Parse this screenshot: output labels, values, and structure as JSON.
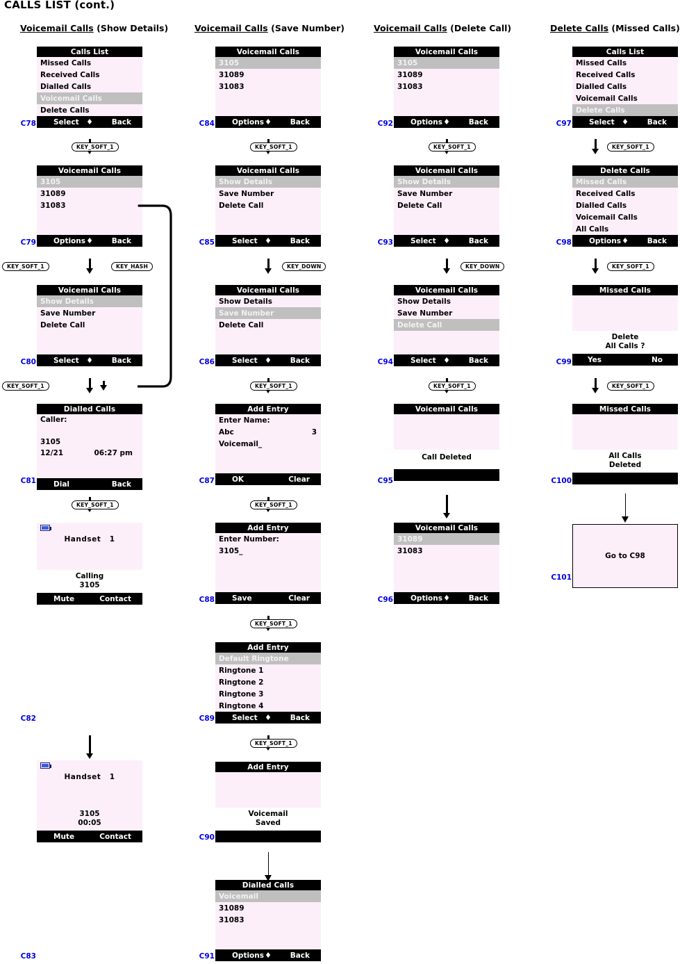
{
  "page": {
    "title": "CALLS LIST (cont.)",
    "columns": [
      {
        "underlined": "Voicemail Calls",
        "rest": " (Show Details)"
      },
      {
        "underlined": "Voicemail Calls",
        "rest": " (Save Number)"
      },
      {
        "underlined": "Voicemail Calls",
        "rest": " (Delete Call)"
      },
      {
        "underlined": "Delete Calls",
        "rest": " (Missed Calls)"
      }
    ]
  },
  "glyphs": {
    "updown": "♦",
    "battery": "battery-icon"
  },
  "keys": {
    "soft1": "KEY_SOFT_1",
    "hash": "KEY_HASH",
    "down": "KEY_DOWN"
  },
  "screens": {
    "C78": {
      "id": "C78",
      "header": "Calls List",
      "items": [
        "Missed Calls",
        "Received Calls",
        "Dialled Calls",
        "Voicemail Calls",
        "Delete Calls"
      ],
      "selected_index": 3,
      "soft": {
        "left": "Select",
        "right": "Back",
        "mid": true
      }
    },
    "C79": {
      "id": "C79",
      "header": "Voicemail Calls",
      "items": [
        "3105",
        "31089",
        "31083"
      ],
      "selected_index": 0,
      "soft": {
        "left": "Options",
        "right": "Back",
        "mid": true
      }
    },
    "C80": {
      "id": "C80",
      "header": "Voicemail Calls",
      "items": [
        "Show Details",
        "Save Number",
        "Delete Call"
      ],
      "selected_index": 0,
      "soft": {
        "left": "Select",
        "right": "Back",
        "mid": true
      }
    },
    "C81": {
      "id": "C81",
      "header": "Dialled Calls",
      "caller_label": "Caller:",
      "number": "3105",
      "date": "12/21",
      "time": "06:27 pm",
      "soft": {
        "left": "Dial",
        "right": "Back",
        "mid": false
      }
    },
    "C82": {
      "id": "C82",
      "handset_label": "Handset",
      "handset_number": "1",
      "status_line1": "Calling",
      "status_line2": "3105",
      "soft": {
        "left": "Mute",
        "right": "Contact",
        "mid": false
      }
    },
    "C83": {
      "id": "C83",
      "handset_label": "Handset",
      "handset_number": "1",
      "status_line1": "3105",
      "status_line2": "00:05",
      "soft": {
        "left": "Mute",
        "right": "Contact",
        "mid": false
      }
    },
    "C84": {
      "id": "C84",
      "header": "Voicemail Calls",
      "items": [
        "3105",
        "31089",
        "31083"
      ],
      "selected_index": 0,
      "soft": {
        "left": "Options",
        "right": "Back",
        "mid": true
      }
    },
    "C85": {
      "id": "C85",
      "header": "Voicemail Calls",
      "items": [
        "Show Details",
        "Save Number",
        "Delete Call"
      ],
      "selected_index": 0,
      "soft": {
        "left": "Select",
        "right": "Back",
        "mid": true
      }
    },
    "C86": {
      "id": "C86",
      "header": "Voicemail Calls",
      "items": [
        "Show Details",
        "Save Number",
        "Delete Call"
      ],
      "selected_index": 1,
      "soft": {
        "left": "Select",
        "right": "Back",
        "mid": true
      }
    },
    "C87": {
      "id": "C87",
      "header": "Add Entry",
      "prompt": "Enter Name:",
      "mode": "Abc",
      "mode_count": "3",
      "value": "Voicemail_",
      "soft": {
        "left": "OK",
        "right": "Clear",
        "mid": false
      }
    },
    "C88": {
      "id": "C88",
      "header": "Add Entry",
      "prompt": "Enter Number:",
      "value": "3105_",
      "soft": {
        "left": "Save",
        "right": "Clear",
        "mid": false
      }
    },
    "C89": {
      "id": "C89",
      "header": "Add Entry",
      "items": [
        "Default Ringtone",
        "Ringtone 1",
        "Ringtone 2",
        "Ringtone 3",
        "Ringtone 4"
      ],
      "selected_index": 0,
      "soft": {
        "left": "Select",
        "right": "Back",
        "mid": true
      }
    },
    "C90": {
      "id": "C90",
      "header": "Add Entry",
      "msg_line1": "Voicemail",
      "msg_line2": "Saved",
      "soft": {
        "left": "",
        "right": "",
        "mid": false
      }
    },
    "C91": {
      "id": "C91",
      "header": "Dialled Calls",
      "items": [
        "Voicemail",
        "31089",
        "31083"
      ],
      "selected_index": 0,
      "soft": {
        "left": "Options",
        "right": "Back",
        "mid": true
      }
    },
    "C92": {
      "id": "C92",
      "header": "Voicemail Calls",
      "items": [
        "3105",
        "31089",
        "31083"
      ],
      "selected_index": 0,
      "soft": {
        "left": "Options",
        "right": "Back",
        "mid": true
      }
    },
    "C93": {
      "id": "C93",
      "header": "Voicemail Calls",
      "items": [
        "Show Details",
        "Save Number",
        "Delete Call"
      ],
      "selected_index": 0,
      "soft": {
        "left": "Select",
        "right": "Back",
        "mid": true
      }
    },
    "C94": {
      "id": "C94",
      "header": "Voicemail Calls",
      "items": [
        "Show Details",
        "Save Number",
        "Delete Call"
      ],
      "selected_index": 2,
      "soft": {
        "left": "Select",
        "right": "Back",
        "mid": true
      }
    },
    "C95": {
      "id": "C95",
      "header": "Voicemail Calls",
      "msg_line1": "Call Deleted",
      "msg_line2": "",
      "soft": {
        "left": "",
        "right": "",
        "mid": false
      }
    },
    "C96": {
      "id": "C96",
      "header": "Voicemail Calls",
      "items": [
        "31089",
        "31083"
      ],
      "selected_index": 0,
      "soft": {
        "left": "Options",
        "right": "Back",
        "mid": true
      }
    },
    "C97": {
      "id": "C97",
      "header": "Calls List",
      "items": [
        "Missed Calls",
        "Received Calls",
        "Dialled Calls",
        "Voicemail Calls",
        "Delete Calls"
      ],
      "selected_index": 4,
      "soft": {
        "left": "Select",
        "right": "Back",
        "mid": true
      }
    },
    "C98": {
      "id": "C98",
      "header": "Delete Calls",
      "items": [
        "Missed Calls",
        "Received Calls",
        "Dialled Calls",
        "Voicemail Calls",
        "All Calls"
      ],
      "selected_index": 0,
      "soft": {
        "left": "Options",
        "right": "Back",
        "mid": true
      }
    },
    "C99": {
      "id": "C99",
      "header": "Missed Calls",
      "msg_line1": "Delete",
      "msg_line2": "All Calls ?",
      "soft": {
        "left": "Yes",
        "right": "No",
        "mid": false
      }
    },
    "C100": {
      "id": "C100",
      "header": "Missed Calls",
      "msg_line1": "All Calls",
      "msg_line2": "Deleted",
      "soft": {
        "left": "",
        "right": "",
        "mid": false
      }
    },
    "C101": {
      "id": "C101",
      "text": "Go to C98"
    }
  }
}
